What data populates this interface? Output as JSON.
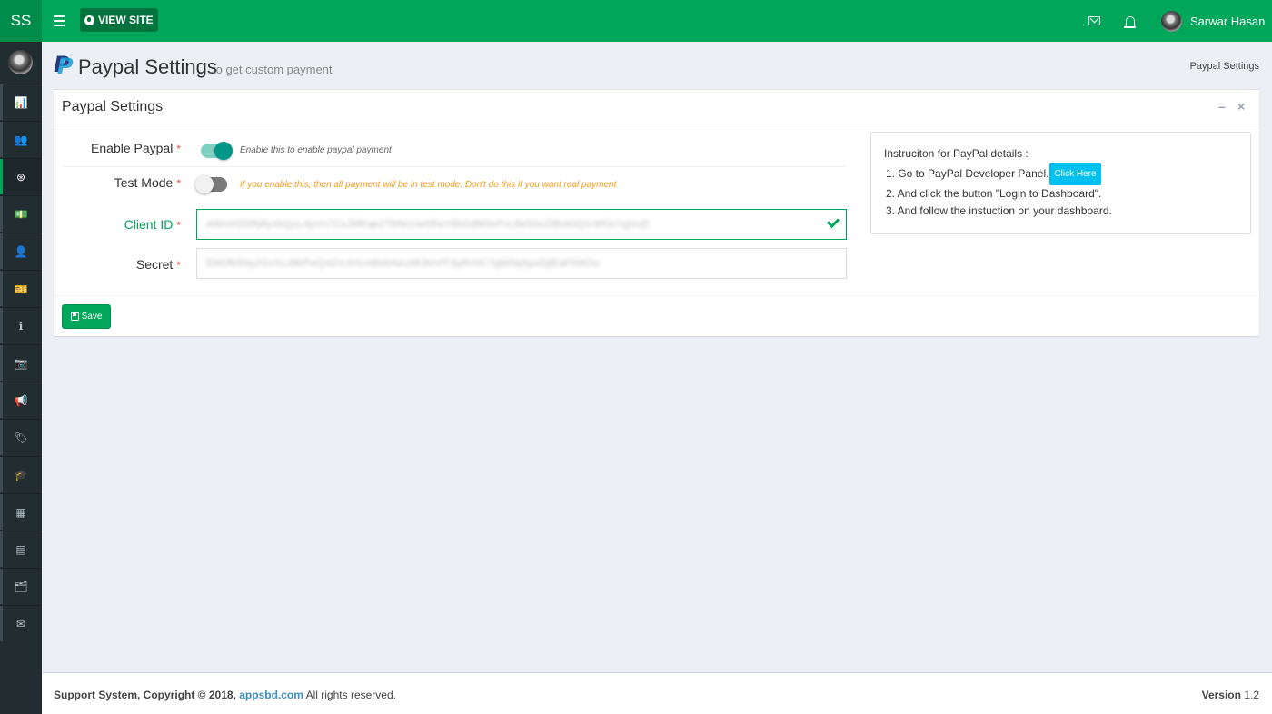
{
  "header": {
    "logo": "SS",
    "view_site": "VIEW SITE",
    "user_name": "Sarwar Hasan"
  },
  "sidebar": {
    "items": [
      {
        "icon": "bar-chart-icon",
        "glyph": "📊"
      },
      {
        "icon": "users-icon",
        "glyph": "👥"
      },
      {
        "icon": "life-ring-icon",
        "glyph": "⊛"
      },
      {
        "icon": "money-icon",
        "glyph": "💵"
      },
      {
        "icon": "user-icon",
        "glyph": "👤"
      },
      {
        "icon": "ticket-icon",
        "glyph": "🎫"
      },
      {
        "icon": "info-icon",
        "glyph": "ℹ"
      },
      {
        "icon": "camera-icon",
        "glyph": "📷"
      },
      {
        "icon": "bullhorn-icon",
        "glyph": "📢"
      },
      {
        "icon": "tag-icon",
        "glyph": "🏷"
      },
      {
        "icon": "graduation-cap-icon",
        "glyph": "🎓"
      },
      {
        "icon": "table-icon",
        "glyph": "▦"
      },
      {
        "icon": "list-icon",
        "glyph": "▤"
      },
      {
        "icon": "sitemap-icon",
        "glyph": "🗂"
      },
      {
        "icon": "envelope-icon",
        "glyph": "✉"
      }
    ]
  },
  "page": {
    "title": "Paypal Settings",
    "subtitle": "to get custom payment",
    "breadcrumb": "Paypal Settings"
  },
  "box": {
    "title": "Paypal Settings",
    "minimize": "–",
    "close": "×"
  },
  "form": {
    "enable_label": "Enable Paypal",
    "enable_help": "Enable this to enable paypal payment",
    "enable_on": true,
    "test_label": "Test Mode",
    "test_help": "If you enable this, then all payment will be in test mode. Don't do this if you want real payment",
    "test_on": false,
    "client_label": "Client ID",
    "client_value": "AWmHZ0Rj8yXkQzL4pVn7CsJ9fKqe2TbNcUw5RaY6hGdM3xPvL8eS0oZiBnKtQ1rWfJcYgVuD",
    "secret_label": "Secret",
    "secret_value": "EM0fb5Ny2GvXcJ8kPwQ4ZrLtH1mBs6AeUdK9oVfT3yRnIiC7gW0qSpxDjlEaFhMOu",
    "required_mark": "*",
    "save_label": "Save"
  },
  "info": {
    "title": "Instruciton for PayPal details :",
    "step1": "1. Go to PayPal Developer Panel.",
    "click_here": "Click Here",
    "step2": "2. And click the button \"Login to Dashboard\".",
    "step3": "3. And follow the instuction on your dashboard."
  },
  "footer": {
    "prefix": "Support System, Copyright © 2018,",
    "link": "appsbd.com",
    "suffix": "All rights reserved.",
    "version_label": "Version",
    "version": "1.2"
  },
  "colors": {
    "brand": "#00a65a",
    "sidebar": "#222d32",
    "warning_text": "#f39c12",
    "info_button": "#00c0ef"
  }
}
